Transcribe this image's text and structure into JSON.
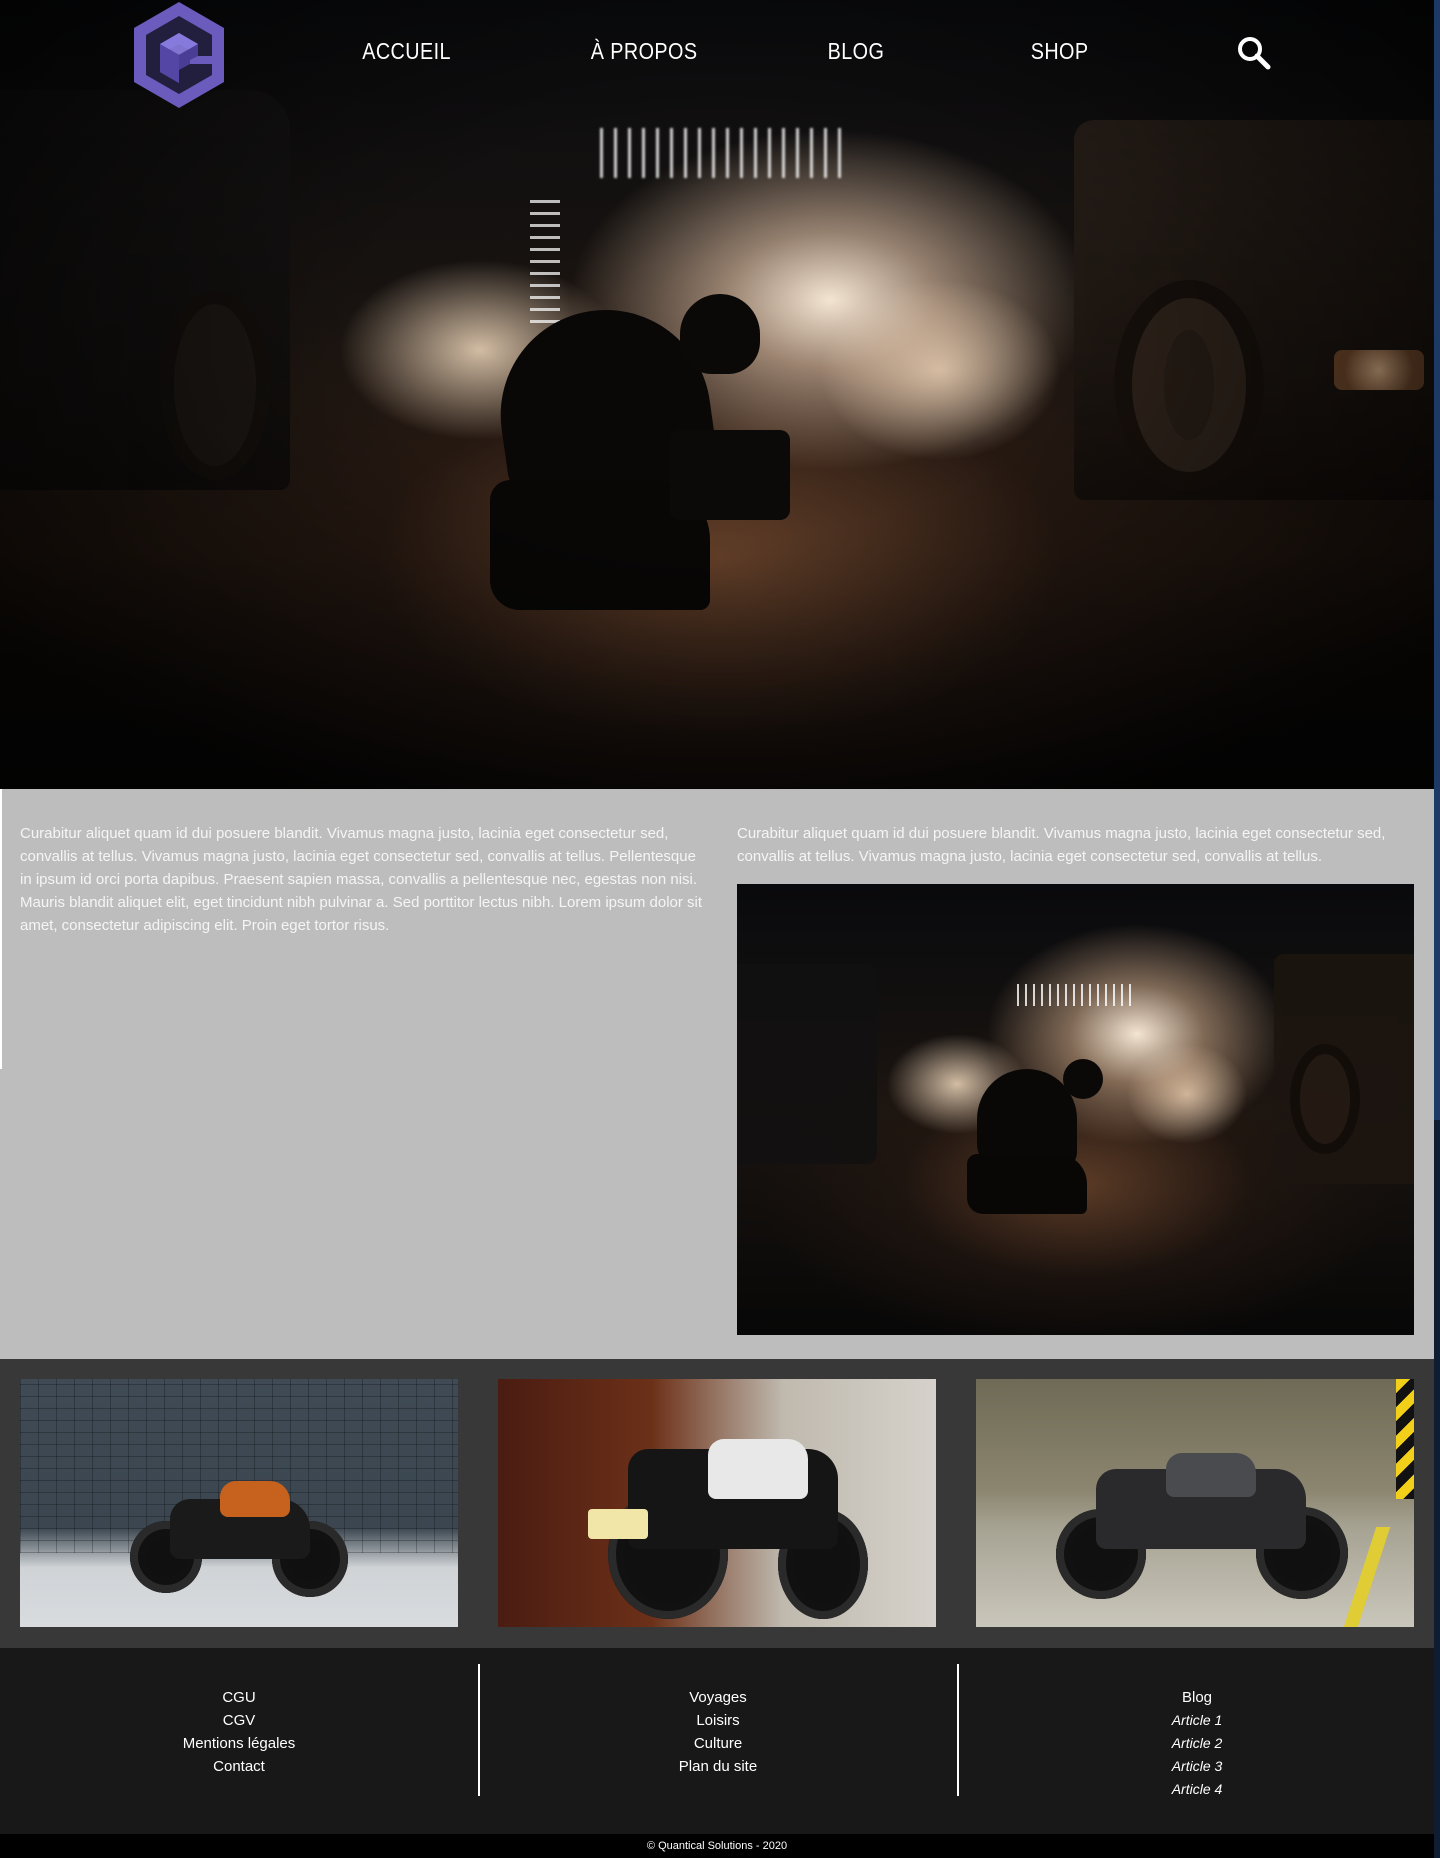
{
  "header": {
    "logo_icon": "hexagon-cube-logo-icon",
    "nav": [
      {
        "label": "ACCUEIL"
      },
      {
        "label": "À PROPOS"
      },
      {
        "label": "BLOG"
      },
      {
        "label": "SHOP"
      }
    ],
    "search_icon": "search-icon"
  },
  "colors": {
    "logo": "#6a5bbd",
    "content_bg": "#bdbdbd",
    "gallery_bg": "#383838",
    "footer_bg": "#181818",
    "copyright_bg": "#000000",
    "edge_accent": "#1d3a66"
  },
  "content": {
    "left_text": "Curabitur aliquet quam id dui posuere blandit. Vivamus magna justo, lacinia eget consectetur sed, convallis at tellus. Vivamus magna justo, lacinia eget consectetur sed, convallis at tellus. Pellentesque in ipsum id orci porta dapibus. Praesent sapien massa, convallis a pellentesque nec, egestas non nisi. Mauris blandit aliquet elit, eget tincidunt nibh pulvinar a. Sed porttitor lectus nibh. Lorem ipsum dolor sit amet, consectetur adipiscing elit. Proin eget tortor risus.",
    "right_text": "Curabitur aliquet quam id dui posuere blandit. Vivamus magna justo, lacinia eget consectetur sed, convallis at tellus. Vivamus magna justo, lacinia eget consectetur sed, convallis at tellus."
  },
  "footer": {
    "col1": [
      "CGU",
      "CGV",
      "Mentions légales",
      "Contact"
    ],
    "col2": [
      "Voyages",
      "Loisirs",
      "Culture",
      "Plan du site"
    ],
    "col3_title": "Blog",
    "col3": [
      "Article 1",
      "Article 2",
      "Article 3",
      "Article 4"
    ],
    "copyright": "© Quantical Solutions - 2020"
  }
}
